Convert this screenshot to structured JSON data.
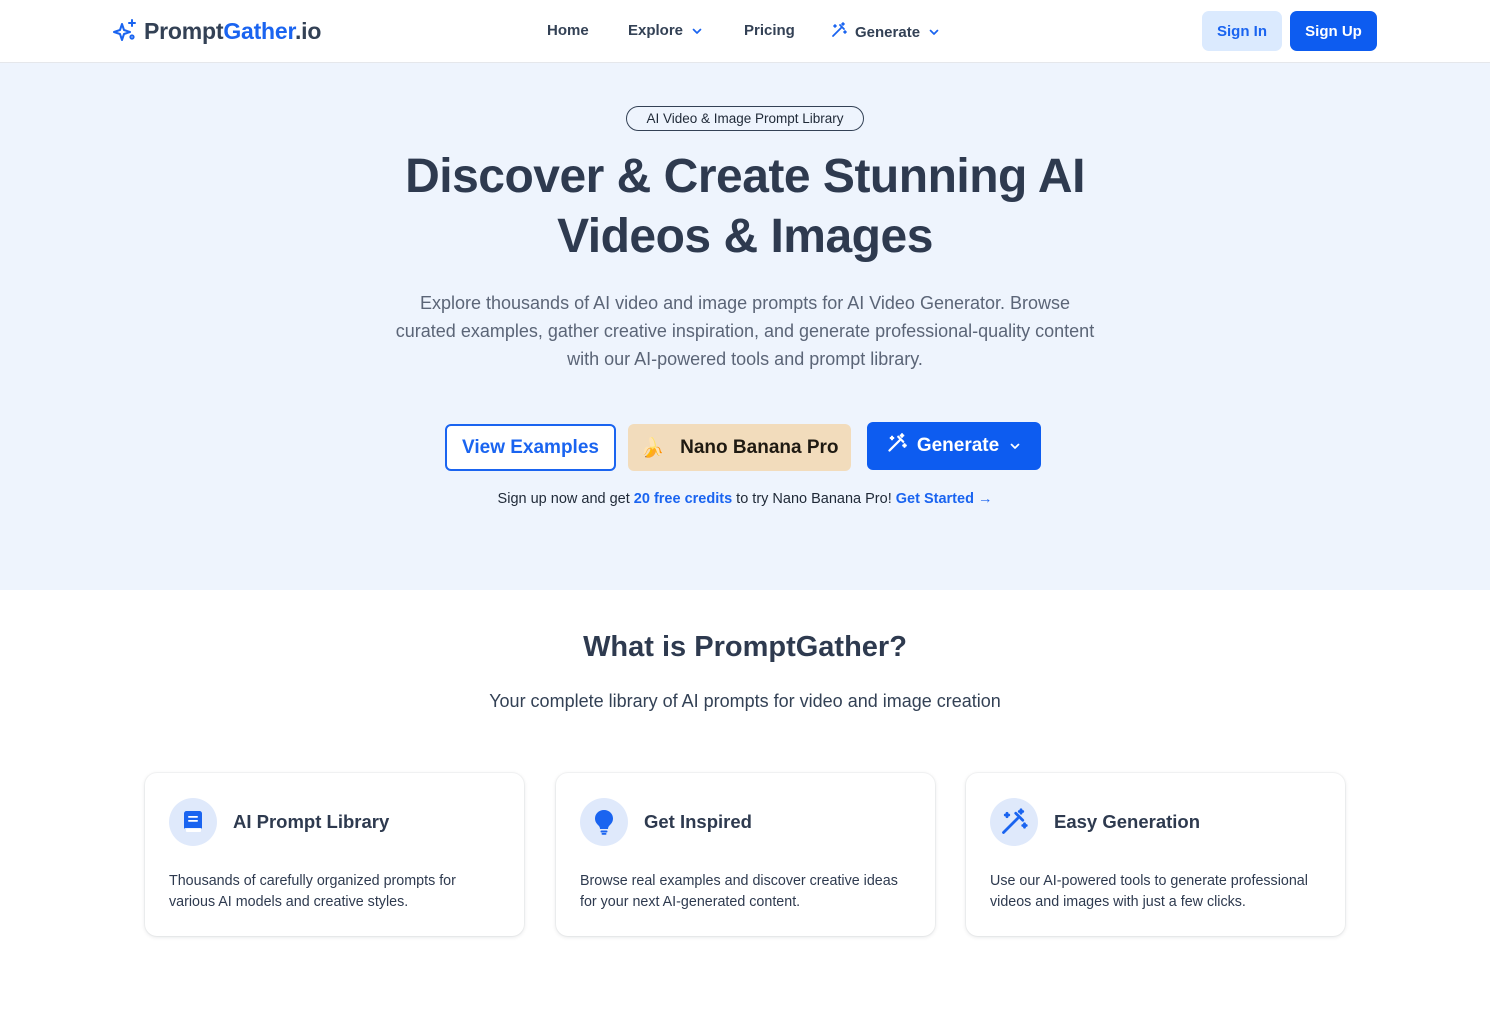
{
  "brand": {
    "part1": "Prompt",
    "part2": "Gather",
    "part3": ".io",
    "icon": "sparkles-icon",
    "accent": "#1a64f0"
  },
  "nav": {
    "home": "Home",
    "explore": "Explore",
    "pricing": "Pricing",
    "generate": "Generate",
    "sign_in": "Sign In",
    "sign_up": "Sign Up"
  },
  "hero": {
    "badge": "AI Video & Image Prompt Library",
    "title": "Discover & Create Stunning AI Videos & Images",
    "description": "Explore thousands of AI video and image prompts for AI Video Generator. Browse curated examples, gather creative inspiration, and generate professional-quality content with our AI-powered tools and prompt library.",
    "btn_view": "View Examples",
    "btn_nano_emoji": "🍌",
    "btn_nano": "Nano Banana Pro",
    "btn_generate": "Generate",
    "signup_pre": "Sign up now and get ",
    "signup_highlight": "20 free credits",
    "signup_post": " to try Nano Banana Pro! ",
    "signup_link": "Get Started →"
  },
  "what": {
    "title": "What is PromptGather?",
    "subtitle": "Your complete library of AI prompts for video and image creation",
    "cards": [
      {
        "icon": "book-icon",
        "title": "AI Prompt Library",
        "text": "Thousands of carefully organized prompts for various AI models and creative styles."
      },
      {
        "icon": "lightbulb-icon",
        "title": "Get Inspired",
        "text": "Browse real examples and discover creative ideas for your next AI-generated content."
      },
      {
        "icon": "magic-wand-icon",
        "title": "Easy Generation",
        "text": "Use our AI-powered tools to generate professional videos and images with just a few clicks."
      }
    ]
  }
}
